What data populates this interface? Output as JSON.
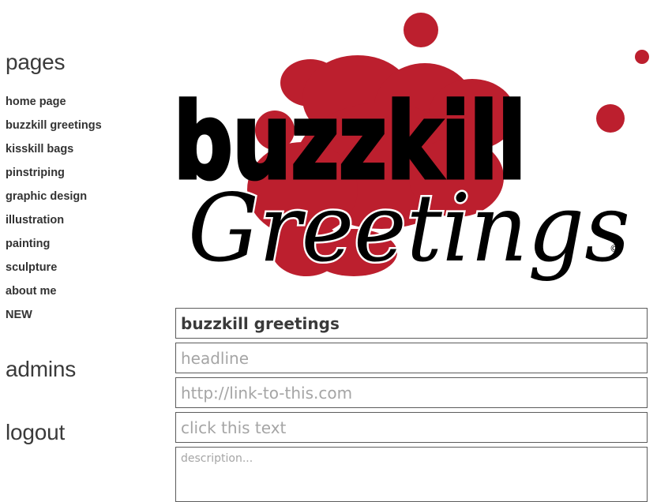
{
  "sidebar": {
    "pages_title": "pages",
    "items": [
      {
        "label": "home page"
      },
      {
        "label": "buzzkill greetings"
      },
      {
        "label": "kisskill bags"
      },
      {
        "label": "pinstriping"
      },
      {
        "label": "graphic design"
      },
      {
        "label": "illustration"
      },
      {
        "label": "painting"
      },
      {
        "label": "sculpture"
      },
      {
        "label": "about me"
      },
      {
        "label": "NEW"
      }
    ],
    "admins_label": "admins",
    "logout_label": "logout"
  },
  "logo": {
    "line1": "buzzkill",
    "line2": "Greetings",
    "copyright": "©",
    "splatter_color": "#bc1f2e",
    "ink_color": "#000000"
  },
  "form": {
    "title_value": "buzzkill greetings",
    "headline_placeholder": "headline",
    "link_placeholder": "http://link-to-this.com",
    "clicktext_placeholder": "click this text",
    "description_placeholder": "description..."
  }
}
